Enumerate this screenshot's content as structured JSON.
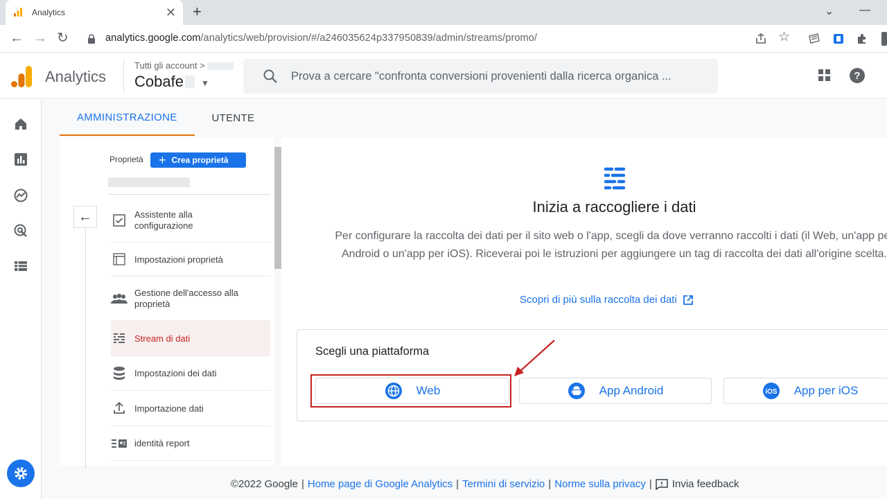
{
  "browser": {
    "tab_title": "Analytics",
    "url_host": "analytics.google.com",
    "url_path": "/analytics/web/provision/#/a246035624p337950839/admin/streams/promo/"
  },
  "header": {
    "app_name": "Analytics",
    "account_crumb": "Tutti gli account",
    "account_name": "Cobafe",
    "search_placeholder": "Prova a cercare \"confronta conversioni provenienti dalla ricerca organica ..."
  },
  "admin_tabs": [
    "AMMINISTRAZIONE",
    "UTENTE"
  ],
  "property": {
    "label": "Proprietà",
    "create_button": "Crea proprietà"
  },
  "menu": [
    {
      "label": "Assistente alla configurazione",
      "icon": "checkbox-icon"
    },
    {
      "label": "Impostazioni proprietà",
      "icon": "layout-icon"
    },
    {
      "label": "Gestione dell'accesso alla proprietà",
      "icon": "people-icon"
    },
    {
      "label": "Stream di dati",
      "icon": "streams-icon",
      "active": true
    },
    {
      "label": "Impostazioni dei dati",
      "icon": "database-icon"
    },
    {
      "label": "Importazione dati",
      "icon": "upload-icon"
    },
    {
      "label": "identità report",
      "icon": "report-identity-icon"
    }
  ],
  "content": {
    "title": "Inizia a raccogliere i dati",
    "description": "Per configurare la raccolta dei dati per il sito web o l'app, scegli da dove verranno raccolti i dati (il Web, un'app per Android o un'app per iOS). Riceverai poi le istruzioni per aggiungere un tag di raccolta dei dati all'origine scelta.",
    "learn_more": "Scopri di più sulla raccolta dei dati",
    "platform_title": "Scegli una piattaforma",
    "platforms": [
      "Web",
      "App Android",
      "App per iOS"
    ]
  },
  "footer": {
    "copyright": "©2022 Google",
    "home_link": "Home page di Google Analytics",
    "terms_link": "Termini di servizio",
    "privacy_link": "Norme sulla privacy",
    "feedback": "Invia feedback"
  },
  "colors": {
    "accent": "#1a73e8",
    "highlight": "#c5221f",
    "tab_indicator": "#e8710a"
  }
}
